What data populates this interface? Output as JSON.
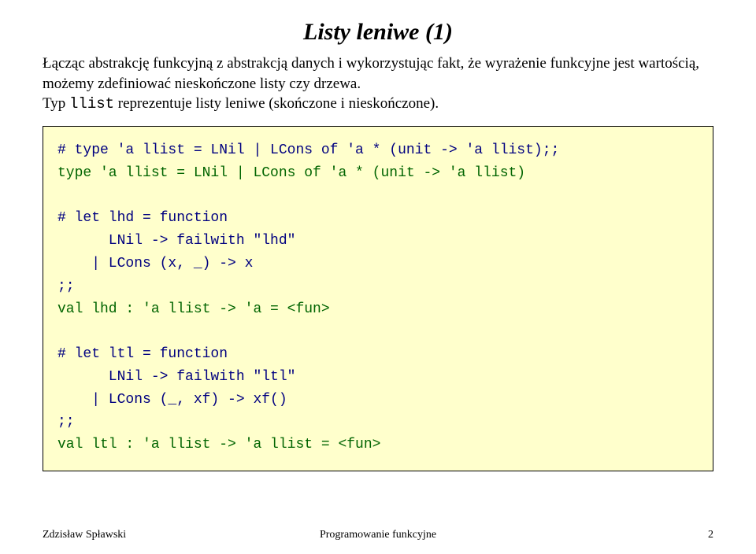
{
  "title": "Listy leniwe (1)",
  "desc_part1": "Łącząc abstrakcję funkcyjną z abstrakcją danych i wykorzystując fakt, że wyrażenie funkcyjne jest wartością, możemy zdefiniować nieskończone listy czy drzewa.",
  "desc_part2a": "Typ ",
  "desc_mono": "llist",
  "desc_part2b": " reprezentuje listy leniwe (skończone i nieskończone).",
  "code": {
    "l1": "# type 'a llist = LNil | LCons of 'a * (unit -> 'a llist);;",
    "l2": "type 'a llist = LNil | LCons of 'a * (unit -> 'a llist)",
    "l3": "",
    "l4": "# let lhd = function",
    "l5": "      LNil -> failwith \"lhd\"",
    "l6": "    | LCons (x, _) -> x",
    "l7": ";;",
    "l8": "val lhd : 'a llist -> 'a = <fun>",
    "l9": "",
    "l10": "# let ltl = function",
    "l11": "      LNil -> failwith \"ltl\"",
    "l12": "    | LCons (_, xf) -> xf()",
    "l13": ";;",
    "l14": "val ltl : 'a llist -> 'a llist = <fun>"
  },
  "footer": {
    "left": "Zdzisław Spławski",
    "center": "Programowanie funkcyjne",
    "right": "2"
  }
}
